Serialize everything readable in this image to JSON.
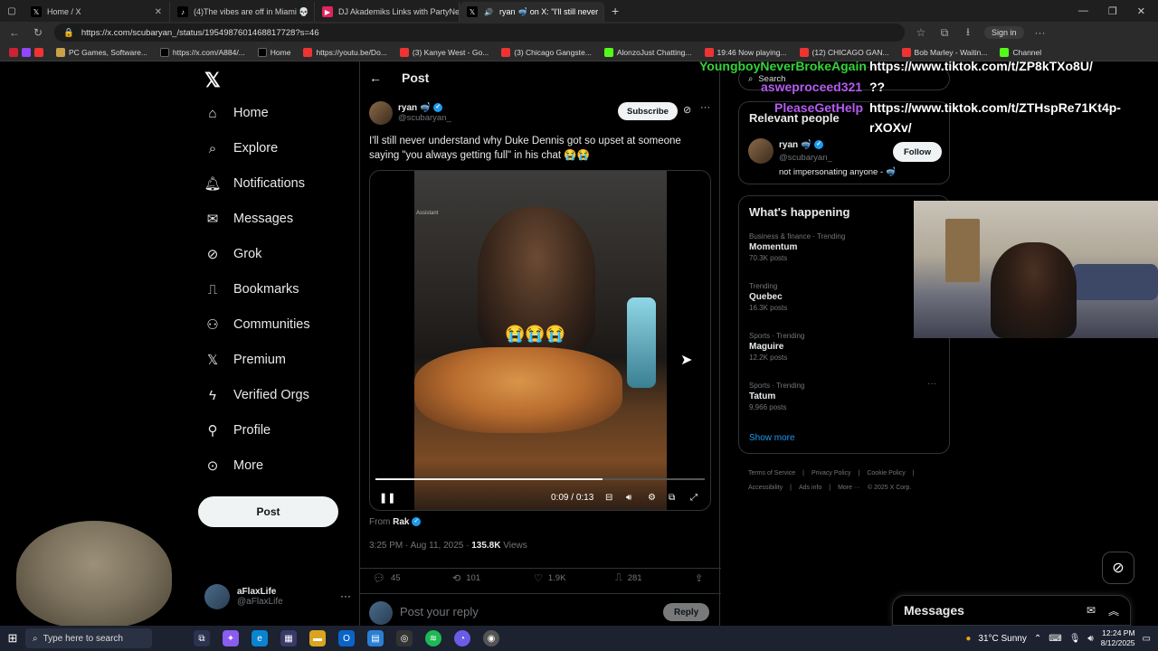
{
  "browser": {
    "tabs": [
      {
        "label": "Home / X",
        "active": false
      },
      {
        "label": "(4)The vibes are off in Miami 💀 ",
        "active": false
      },
      {
        "label": "DJ Akademiks Links with PartyNe",
        "active": false
      },
      {
        "label": "ryan 🤿 on X: \"I'll still never",
        "active": true
      }
    ],
    "url": "https://x.com/scubaryan_/status/1954987601468817728?s=46",
    "signin": "Sign in",
    "bookmarks": [
      "PC Games, Software...",
      "https://x.com/A884/...",
      "Home",
      "https://youtu.be/Do...",
      "(3) Kanye West - Go...",
      "(3) Chicago Gangste...",
      "AlonzoJust Chatting...",
      "19:46 Now playing...",
      "(12) CHICAGO GAN...",
      "Bob Marley - Waitin...",
      "Channel"
    ]
  },
  "nav": {
    "items": [
      "Home",
      "Explore",
      "Notifications",
      "Messages",
      "Grok",
      "Bookmarks",
      "Communities",
      "Premium",
      "Verified Orgs",
      "Profile",
      "More"
    ],
    "post_button": "Post",
    "account": {
      "name": "aFlaxLife",
      "handle": "@aFlaxLife"
    }
  },
  "post": {
    "header": "Post",
    "author": {
      "name": "ryan 🤿",
      "handle": "@scubaryan_"
    },
    "subscribe": "Subscribe",
    "text": "I'll still never understand why Duke Dennis got so upset at someone saying \"you always getting full\" in his chat 😭😭",
    "video": {
      "current_time": "0:09",
      "separator": " / ",
      "duration": "0:13",
      "progress": 0.69,
      "emoji_overlay": "😭😭😭"
    },
    "from_label": "From",
    "from_name": "Rak",
    "timestamp": "3:25 PM · Aug 11, 2025 · ",
    "views": "135.8K",
    "views_label": " Views",
    "replies": "45",
    "reposts": "101",
    "likes": "1.9K",
    "bookmarks": "281",
    "reply_placeholder": "Post your reply",
    "reply_button": "Reply"
  },
  "sidebar": {
    "search_placeholder": "Search",
    "relevant_people": {
      "title": "Relevant people",
      "name": "ryan 🤿",
      "handle": "@scubaryan_",
      "bio": "not impersonating anyone - 🤿",
      "follow": "Follow"
    },
    "happening": {
      "title": "What's happening",
      "trends": [
        {
          "category": "Business & finance · Trending",
          "topic": "Momentum",
          "count": "70.3K posts"
        },
        {
          "category": "Trending",
          "topic": "Quebec",
          "count": "16.3K posts"
        },
        {
          "category": "Sports · Trending",
          "topic": "Maguire",
          "count": "12.2K posts"
        },
        {
          "category": "Sports · Trending",
          "topic": "Tatum",
          "count": "9,966 posts"
        }
      ],
      "show_more": "Show more"
    },
    "footer": [
      "Terms of Service",
      "|",
      "Privacy Policy",
      "|",
      "Cookie Policy",
      "|",
      "Accessibility",
      "|",
      "Ads info",
      "|",
      "More ···",
      "© 2025 X Corp."
    ]
  },
  "overlays": {
    "green_name": "YoungboyNeverBrokeAgain",
    "link1": "https://www.tiktok.com/t/ZP8kTXo8U/",
    "purple1": "asweproceed321",
    "q": "??",
    "purple2": "PleaseGetHelp",
    "link2a": "https://www.tiktok.com/t/ZTHspRe71Kt4p-",
    "link2b": "rXOXv/"
  },
  "messages_drawer": {
    "title": "Messages"
  },
  "taskbar": {
    "search": "Type here to search",
    "weather": "31°C  Sunny",
    "time": "12:24 PM",
    "date": "8/12/2025"
  },
  "colors": {
    "accent": "#1d9bf0",
    "overlay_green": "#34d43a",
    "overlay_purple": "#b45cf0"
  }
}
